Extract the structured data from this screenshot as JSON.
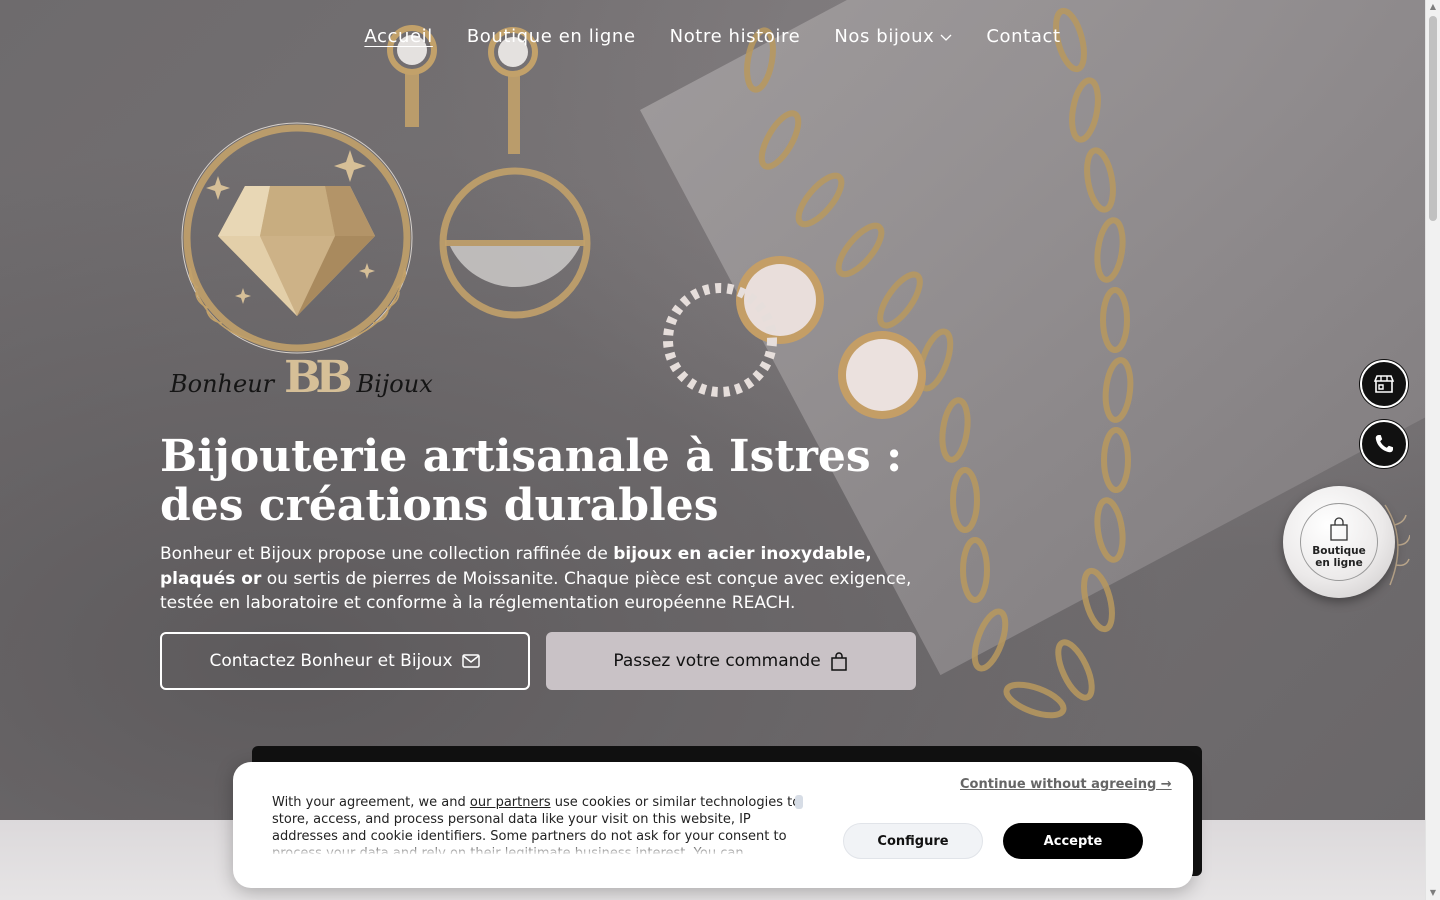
{
  "nav": {
    "items": [
      {
        "label": "Accueil",
        "active": true
      },
      {
        "label": "Boutique en ligne"
      },
      {
        "label": "Notre histoire"
      },
      {
        "label": "Nos bijoux",
        "has_dropdown": true
      },
      {
        "label": "Contact"
      }
    ]
  },
  "logo": {
    "word_left": "Bonheur",
    "monogram": "BB",
    "word_right": "Bijoux"
  },
  "hero": {
    "title": "Bijouterie artisanale à Istres : des créations durables",
    "text_part1": "Bonheur et Bijoux propose une collection raffinée de ",
    "text_bold": "bijoux en acier inoxydable, plaqués or",
    "text_part2": " ou sertis de pierres de Moissanite. Chaque pièce est conçue avec exigence, testée en laboratoire et conforme à la réglementation européenne REACH.",
    "contact_button": "Contactez Bonheur et Bijoux",
    "order_button": "Passez votre commande"
  },
  "side": {
    "shop_icon": "storefront-icon",
    "phone_icon": "phone-icon",
    "badge_line1": "Boutique",
    "badge_line2": "en ligne"
  },
  "cookie": {
    "continue_label": "Continue without agreeing →",
    "text_before_link": "With your agreement, we and ",
    "link_label": "our partners",
    "text_after_link": " use cookies or similar technologies to store, access, and process personal data like your visit on this website, IP addresses and cookie identifiers. Some partners do not ask for your consent to process your data and rely on their legitimate business interest. You can",
    "configure_label": "Configure",
    "accept_label": "Accepte"
  },
  "colors": {
    "gold": "#d6bf97",
    "dark": "#111111",
    "order_button_bg": "#c9c2c6"
  }
}
